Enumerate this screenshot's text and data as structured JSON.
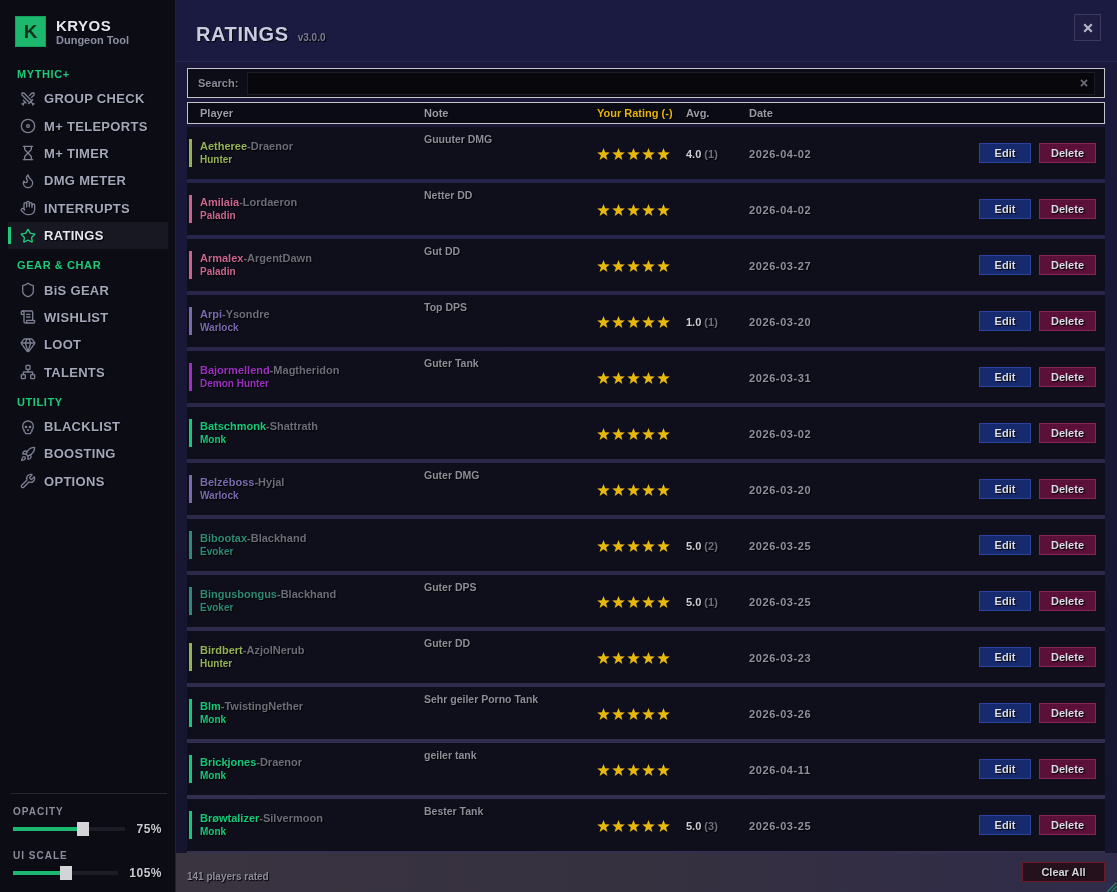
{
  "sidebar": {
    "logo": {
      "letter": "K",
      "title": "KRYOS",
      "subtitle": "Dungeon Tool"
    },
    "sections": [
      {
        "title": "MYTHIC+",
        "items": [
          {
            "label": "GROUP CHECK",
            "selected": false
          },
          {
            "label": "M+ TELEPORTS",
            "selected": false
          },
          {
            "label": "M+ TIMER",
            "selected": false
          },
          {
            "label": "DMG METER",
            "selected": false
          },
          {
            "label": "INTERRUPTS",
            "selected": false
          },
          {
            "label": "RATINGS",
            "selected": true
          }
        ]
      },
      {
        "title": "GEAR & CHAR",
        "items": [
          {
            "label": "BiS GEAR",
            "selected": false
          },
          {
            "label": "WISHLIST",
            "selected": false
          },
          {
            "label": "LOOT",
            "selected": false
          },
          {
            "label": "TALENTS",
            "selected": false
          }
        ]
      },
      {
        "title": "UTILITY",
        "items": [
          {
            "label": "BLACKLIST",
            "selected": false
          },
          {
            "label": "BOOSTING",
            "selected": false
          },
          {
            "label": "OPTIONS",
            "selected": false
          }
        ]
      }
    ],
    "sliders": [
      {
        "label": "OPACITY",
        "level": 0.64,
        "reading": "75%"
      },
      {
        "label": "UI SCALE",
        "level": 0.5,
        "reading": "105%"
      }
    ]
  },
  "header": {
    "title": "RATINGS",
    "version": "v3.0.0"
  },
  "search": {
    "label": "Search:"
  },
  "table": {
    "columns": [
      {
        "label": "Player",
        "selected": false
      },
      {
        "label": "Note",
        "selected": false
      },
      {
        "label": "Your Rating (-)",
        "selected": true
      },
      {
        "label": "Avg.",
        "selected": false
      },
      {
        "label": "Date",
        "selected": false
      }
    ],
    "rows": [
      {
        "name": "Aetheree",
        "realm": "-Draenor",
        "class": "Hunter",
        "color": "#94b354",
        "note": "Guuuter DMG",
        "stars": 5,
        "average": "4.0",
        "count": "(1)",
        "date": "2026-04-02",
        "actions": [
          {
            "label": "Edit",
            "kind": "edit"
          },
          {
            "label": "Delete",
            "kind": "delete"
          }
        ]
      },
      {
        "name": "Amilaia",
        "realm": "-Lordaeron",
        "class": "Paladin",
        "color": "#c9648f",
        "note": "Netter DD",
        "stars": 5,
        "date": "2026-04-02",
        "actions": [
          {
            "label": "Edit",
            "kind": "edit"
          },
          {
            "label": "Delete",
            "kind": "delete"
          }
        ]
      },
      {
        "name": "Armalex",
        "realm": "-ArgentDawn",
        "class": "Paladin",
        "color": "#c9648f",
        "note": "Gut DD",
        "stars": 5,
        "date": "2026-03-27",
        "actions": [
          {
            "label": "Edit",
            "kind": "edit"
          },
          {
            "label": "Delete",
            "kind": "delete"
          }
        ]
      },
      {
        "name": "Arpi",
        "realm": "-Ysondre",
        "class": "Warlock",
        "color": "#7a6bb0",
        "note": "Top DPS",
        "stars": 5,
        "average": "1.0",
        "count": "(1)",
        "date": "2026-03-20",
        "actions": [
          {
            "label": "Edit",
            "kind": "edit"
          },
          {
            "label": "Delete",
            "kind": "delete"
          }
        ]
      },
      {
        "name": "Bajormellend",
        "realm": "-Magtheridon",
        "class": "Demon Hunter",
        "color": "#9b30c2",
        "note": "Guter Tank",
        "stars": 5,
        "date": "2026-03-31",
        "actions": [
          {
            "label": "Edit",
            "kind": "edit"
          },
          {
            "label": "Delete",
            "kind": "delete"
          }
        ]
      },
      {
        "name": "Batschmonk",
        "realm": "-Shattrath",
        "class": "Monk",
        "color": "#14c97c",
        "stars": 5,
        "date": "2026-03-02",
        "actions": [
          {
            "label": "Edit",
            "kind": "edit"
          },
          {
            "label": "Delete",
            "kind": "delete"
          }
        ]
      },
      {
        "name": "Belzéboss",
        "realm": "-Hyjal",
        "class": "Warlock",
        "color": "#7a6bb0",
        "note": "Guter DMG",
        "stars": 5,
        "date": "2026-03-20",
        "actions": [
          {
            "label": "Edit",
            "kind": "edit"
          },
          {
            "label": "Delete",
            "kind": "delete"
          }
        ]
      },
      {
        "name": "Bibootax",
        "realm": "-Blackhand",
        "class": "Evoker",
        "color": "#2f8a77",
        "stars": 5,
        "average": "5.0",
        "count": "(2)",
        "date": "2026-03-25",
        "actions": [
          {
            "label": "Edit",
            "kind": "edit"
          },
          {
            "label": "Delete",
            "kind": "delete"
          }
        ]
      },
      {
        "name": "Bingusbongus",
        "realm": "-Blackhand",
        "class": "Evoker",
        "color": "#2f8a77",
        "note": "Guter DPS",
        "stars": 5,
        "average": "5.0",
        "count": "(1)",
        "date": "2026-03-25",
        "actions": [
          {
            "label": "Edit",
            "kind": "edit"
          },
          {
            "label": "Delete",
            "kind": "delete"
          }
        ]
      },
      {
        "name": "Birdbert",
        "realm": "-AzjolNerub",
        "class": "Hunter",
        "color": "#94b354",
        "note": "Guter DD",
        "stars": 5,
        "date": "2026-03-23",
        "actions": [
          {
            "label": "Edit",
            "kind": "edit"
          },
          {
            "label": "Delete",
            "kind": "delete"
          }
        ]
      },
      {
        "name": "Blm",
        "realm": "-TwistingNether",
        "class": "Monk",
        "color": "#14c97c",
        "note": "Sehr geiler Porno Tank",
        "stars": 5,
        "date": "2026-03-26",
        "actions": [
          {
            "label": "Edit",
            "kind": "edit"
          },
          {
            "label": "Delete",
            "kind": "delete"
          }
        ]
      },
      {
        "name": "Brickjones",
        "realm": "-Draenor",
        "class": "Monk",
        "color": "#14c97c",
        "note": "geiler tank",
        "stars": 5,
        "date": "2026-04-11",
        "actions": [
          {
            "label": "Edit",
            "kind": "edit"
          },
          {
            "label": "Delete",
            "kind": "delete"
          }
        ]
      },
      {
        "name": "Brøwtalizer",
        "realm": "-Silvermoon",
        "class": "Monk",
        "color": "#14c97c",
        "note": "Bester Tank",
        "stars": 5,
        "average": "5.0",
        "count": "(3)",
        "date": "2026-03-25",
        "actions": [
          {
            "label": "Edit",
            "kind": "edit"
          },
          {
            "label": "Delete",
            "kind": "delete"
          }
        ]
      }
    ]
  },
  "footer": {
    "summary": "141 players rated",
    "button": "Clear All"
  }
}
